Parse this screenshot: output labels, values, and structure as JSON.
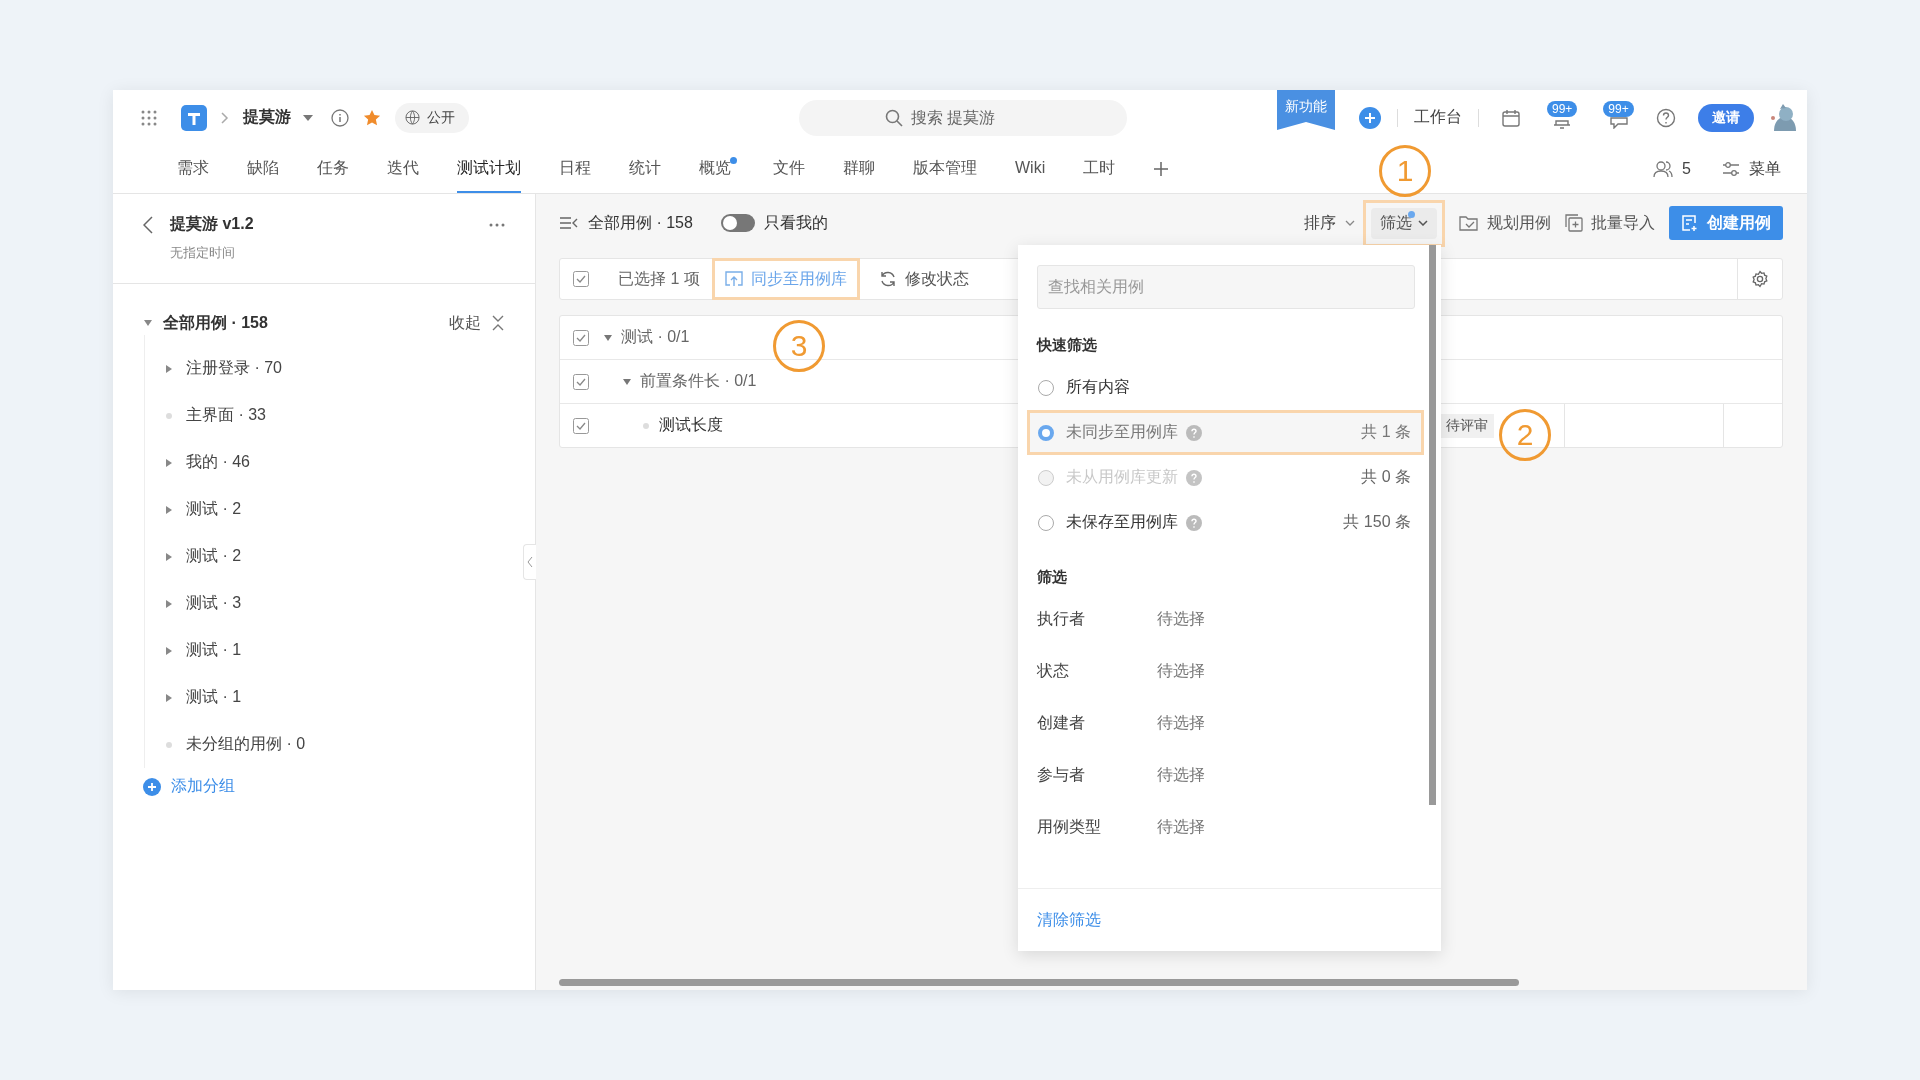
{
  "topbar": {
    "project": "提莫游",
    "visibility": "公开",
    "search_placeholder": "搜索 提莫游",
    "new_feature": "新功能",
    "workbench": "工作台",
    "badges": [
      "99+",
      "99+"
    ],
    "invite": "邀请"
  },
  "tabs": [
    {
      "label": "需求",
      "selected": false,
      "dot": false
    },
    {
      "label": "缺陷",
      "selected": false,
      "dot": false
    },
    {
      "label": "任务",
      "selected": false,
      "dot": false
    },
    {
      "label": "迭代",
      "selected": false,
      "dot": false
    },
    {
      "label": "测试计划",
      "selected": true,
      "dot": false
    },
    {
      "label": "日程",
      "selected": false,
      "dot": false
    },
    {
      "label": "统计",
      "selected": false,
      "dot": false
    },
    {
      "label": "概览",
      "selected": false,
      "dot": true
    },
    {
      "label": "文件",
      "selected": false,
      "dot": false
    },
    {
      "label": "群聊",
      "selected": false,
      "dot": false
    },
    {
      "label": "版本管理",
      "selected": false,
      "dot": false
    },
    {
      "label": "Wiki",
      "selected": false,
      "dot": false
    },
    {
      "label": "工时",
      "selected": false,
      "dot": false
    }
  ],
  "nav_right": {
    "members": "5",
    "menu": "菜单"
  },
  "sidebar": {
    "title": "提莫游 v1.2",
    "subtitle": "无指定时间",
    "tree": {
      "label": "全部用例 · 158",
      "expanded": true,
      "collapse": "收起",
      "children": [
        {
          "label": "注册登录 · 70",
          "kind": "group"
        },
        {
          "label": "主界面 · 33",
          "kind": "leaf"
        },
        {
          "label": "我的 · 46",
          "kind": "group"
        },
        {
          "label": "测试 · 2",
          "kind": "group"
        },
        {
          "label": "测试 · 2",
          "kind": "group"
        },
        {
          "label": "测试 · 3",
          "kind": "group"
        },
        {
          "label": "测试 · 1",
          "kind": "group"
        },
        {
          "label": "测试 · 1",
          "kind": "group"
        },
        {
          "label": "未分组的用例 · 0",
          "kind": "leaf"
        }
      ]
    },
    "add_group": "添加分组"
  },
  "toolbar": {
    "all": "全部用例 · 158",
    "only_mine": {
      "label": "只看我的",
      "on": false
    },
    "sort": "排序",
    "filter": {
      "label": "筛选",
      "highlighted": true
    },
    "plan": "规划用例",
    "import": "批量导入",
    "create": "创建用例"
  },
  "selection_bar": {
    "checked": true,
    "count": "已选择 1 项",
    "actions": [
      {
        "label": "同步至用例库",
        "highlighted": true,
        "kind": "sync"
      },
      {
        "label": "修改状态",
        "highlighted": false,
        "kind": "status"
      }
    ]
  },
  "rows": [
    {
      "kind": "group",
      "label": "测试 · 0/1",
      "checked": true,
      "expanded": true,
      "children": [
        {
          "kind": "group",
          "label": "前置条件长 · 0/1",
          "checked": true,
          "expanded": true,
          "children": [
            {
              "kind": "case",
              "label": "测试长度",
              "checked": true,
              "status": "待评审"
            }
          ]
        }
      ]
    }
  ],
  "filter_panel": {
    "search_placeholder": "查找相关用例",
    "quick_title": "快速筛选",
    "quick": [
      {
        "label": "所有内容",
        "selected": false,
        "disabled": false,
        "help": false,
        "highlighted": false
      },
      {
        "label": "未同步至用例库",
        "selected": true,
        "disabled": false,
        "help": true,
        "count": "共 1 条",
        "highlighted": true
      },
      {
        "label": "未从用例库更新",
        "selected": false,
        "disabled": true,
        "help": true,
        "count": "共 0 条",
        "highlighted": false
      },
      {
        "label": "未保存至用例库",
        "selected": false,
        "disabled": false,
        "help": true,
        "count": "共 150 条",
        "highlighted": false
      }
    ],
    "filter_title": "筛选",
    "filters": [
      {
        "label": "执行者",
        "value": "待选择"
      },
      {
        "label": "状态",
        "value": "待选择"
      },
      {
        "label": "创建者",
        "value": "待选择"
      },
      {
        "label": "参与者",
        "value": "待选择"
      },
      {
        "label": "用例类型",
        "value": "待选择"
      }
    ],
    "clear": "清除筛选"
  },
  "annotations": [
    {
      "label": "1"
    },
    {
      "label": "2"
    },
    {
      "label": "3"
    }
  ]
}
